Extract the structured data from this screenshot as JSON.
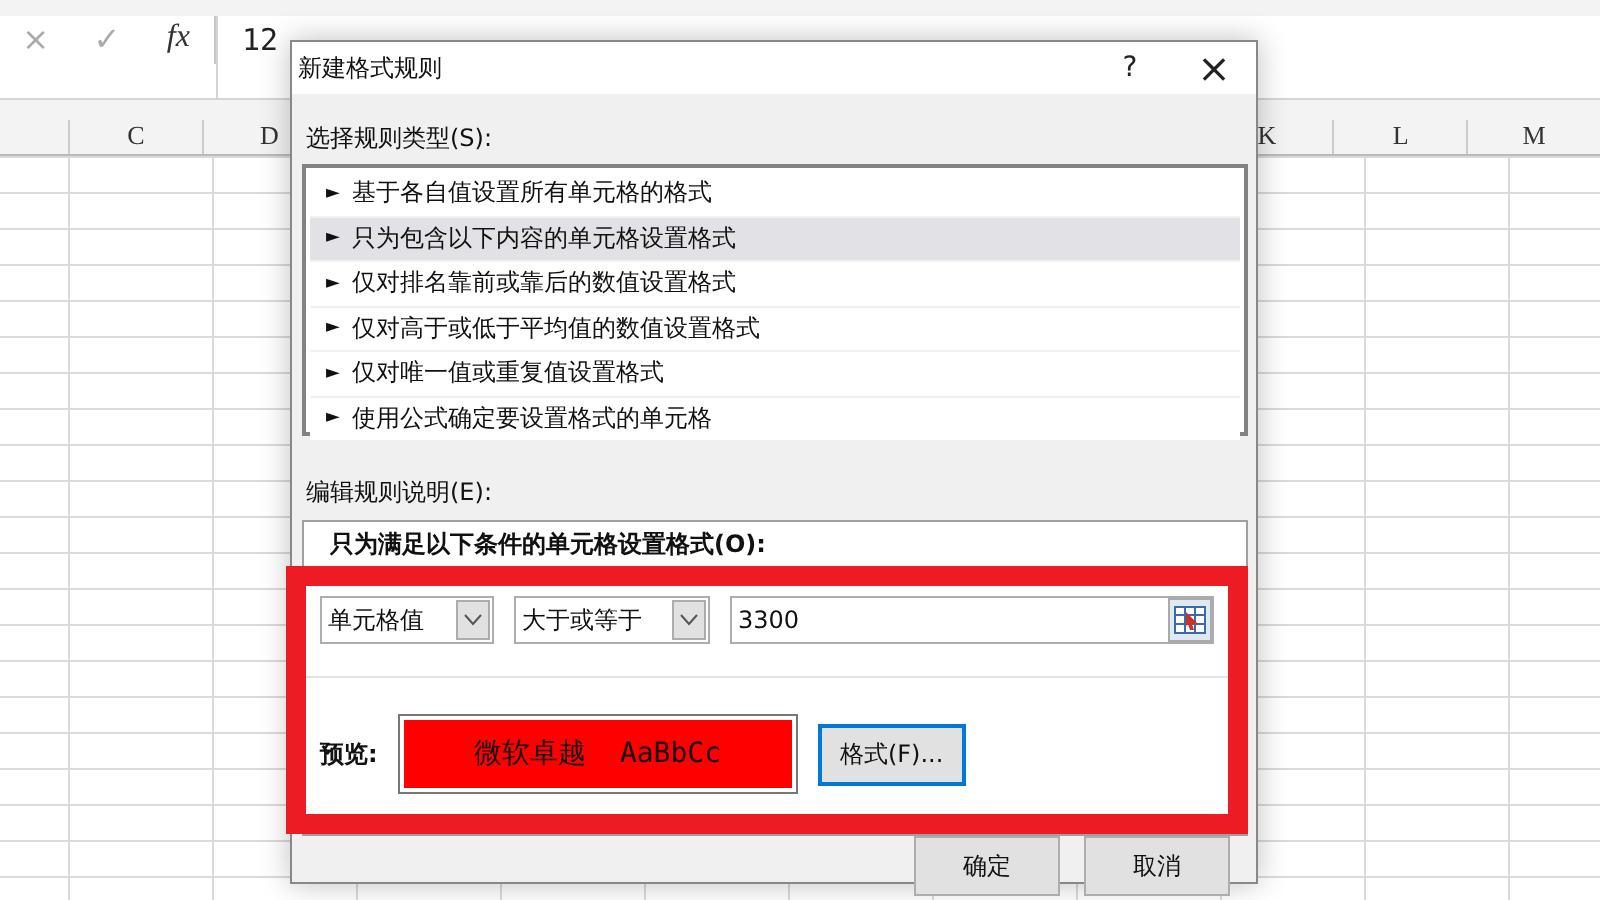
{
  "formula_bar": {
    "cancel": "×",
    "enter": "✓",
    "fx": "fx",
    "value": "12"
  },
  "sheet": {
    "columns": [
      {
        "label": "C"
      },
      {
        "label": "D"
      },
      {
        "label": "K"
      },
      {
        "label": "L"
      },
      {
        "label": "M"
      }
    ]
  },
  "dialog": {
    "title": "新建格式规则",
    "help": "?",
    "close": "×",
    "rule_type_label": "选择规则类型(S):",
    "rule_types": [
      {
        "label": "基于各自值设置所有单元格的格式",
        "selected": false
      },
      {
        "label": "只为包含以下内容的单元格设置格式",
        "selected": true
      },
      {
        "label": "仅对排名靠前或靠后的数值设置格式",
        "selected": false
      },
      {
        "label": "仅对高于或低于平均值的数值设置格式",
        "selected": false
      },
      {
        "label": "仅对唯一值或重复值设置格式",
        "selected": false
      },
      {
        "label": "使用公式确定要设置格式的单元格",
        "selected": false
      }
    ],
    "marker": "►",
    "edit_label": "编辑规则说明(E):",
    "condition_heading": "只为满足以下条件的单元格设置格式(O):",
    "condition": {
      "field": "单元格值",
      "operator": "大于或等于",
      "value": "3300"
    },
    "preview_label": "预览:",
    "preview_text": "微软卓越  AaBbCc",
    "format_button": "格式(F)...",
    "buttons": [
      "确定",
      "取消"
    ]
  }
}
